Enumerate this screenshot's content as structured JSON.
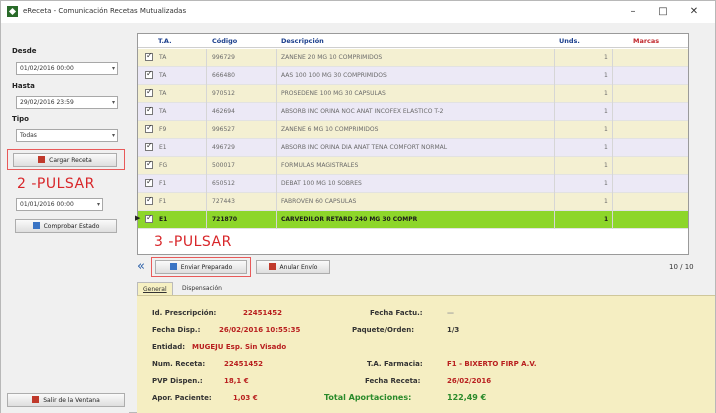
{
  "window": {
    "title": "eReceta - Comunicación Recetas Mutualizadas",
    "minimize": "–",
    "maximize": "□",
    "close": "✕"
  },
  "sidebar": {
    "desde_label": "Desde",
    "desde_value": "01/02/2016 00:00",
    "hasta_label": "Hasta",
    "hasta_value": "29/02/2016 23:59",
    "tipo_label": "Tipo",
    "tipo_value": "Todas",
    "cargar_button": "Cargar Receta",
    "date2_value": "01/01/2016 00:00",
    "comprobar_button": "Comprobar Estado",
    "salir_button": "Salir de la Ventana"
  },
  "annotations": {
    "step2": "2 -PULSAR",
    "step3": "3 -PULSAR"
  },
  "grid": {
    "columns": [
      "T.A.",
      "Código",
      "Descripción",
      "Unds.",
      "Marcas"
    ],
    "rows": [
      {
        "ta": "TA",
        "codigo": "996729",
        "descripcion": "ZANENE 20 MG 10 COMPRIMIDOS",
        "unds": "1",
        "selected": false
      },
      {
        "ta": "TA",
        "codigo": "666480",
        "descripcion": "AAS 100 100 MG 30 COMPRIMIDOS",
        "unds": "1",
        "selected": false
      },
      {
        "ta": "TA",
        "codigo": "970512",
        "descripcion": "PROSEDENE 100 MG 30 CAPSULAS",
        "unds": "1",
        "selected": false
      },
      {
        "ta": "TA",
        "codigo": "462694",
        "descripcion": "ABSORB INC ORINA NOC ANAT INCOFEX ELASTICO T-2",
        "unds": "1",
        "selected": false
      },
      {
        "ta": "F9",
        "codigo": "996527",
        "descripcion": "ZANENE 6 MG 10 COMPRIMIDOS",
        "unds": "1",
        "selected": false
      },
      {
        "ta": "E1",
        "codigo": "496729",
        "descripcion": "ABSORB INC ORINA DIA ANAT TENA COMFORT NORMAL",
        "unds": "1",
        "selected": false
      },
      {
        "ta": "FG",
        "codigo": "500017",
        "descripcion": "FORMULAS MAGISTRALES",
        "unds": "1",
        "selected": false
      },
      {
        "ta": "F1",
        "codigo": "650512",
        "descripcion": "DEBAT 100 MG 10 SOBRES",
        "unds": "1",
        "selected": false
      },
      {
        "ta": "F1",
        "codigo": "727443",
        "descripcion": "FABROVEN 60 CAPSULAS",
        "unds": "1",
        "selected": false
      },
      {
        "ta": "E1",
        "codigo": "721870",
        "descripcion": "CARVEDILOR RETARD 240 MG 30 COMPR",
        "unds": "1",
        "selected": true
      }
    ],
    "row_marker": "▶"
  },
  "toolbar": {
    "enviar_button": "Enviar Preparado",
    "anular_button": "Anular Envío",
    "counter": "10 / 10",
    "nav_arrow": "«"
  },
  "tabs": [
    "General",
    "Dispensación"
  ],
  "detail": {
    "id_label": "Id. Prescripción:",
    "id_value": "22451452",
    "fecha_factura_label": "Fecha Factu.:",
    "fecha_factura_value": "—",
    "fecha_disp_label": "Fecha Disp.:",
    "fecha_disp_value": "26/02/2016 10:55:35",
    "paquete_label": "Paquete/Orden:",
    "paquete_value": "1/3",
    "entidad_label": "Entidad:",
    "entidad_value": "MUGEJU Esp. Sin Visado",
    "num_receta_label": "Num. Receta:",
    "num_receta_value": "22451452",
    "ta_farmacia_label": "T.A. Farmacia:",
    "ta_farmacia_value": "F1 - BIXERTO FIRP A.V.",
    "pvp_label": "PVP Dispen.:",
    "pvp_value": "18,1 €",
    "fecha_receta_label": "Fecha Receta:",
    "fecha_receta_value": "26/02/2016",
    "aport_label": "Apor. Paciente:",
    "aport_value": "1,03 €",
    "total_label": "Total Aportaciones:",
    "total_value": "122,49 €"
  }
}
